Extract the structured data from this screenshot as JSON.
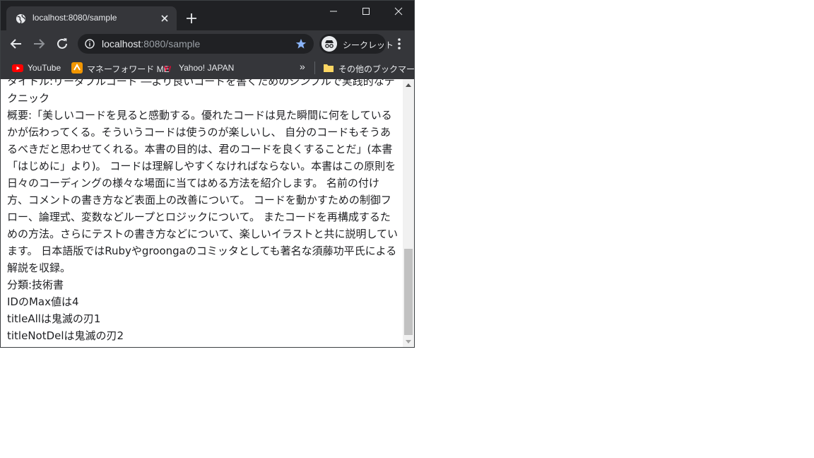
{
  "browser": {
    "tab_title": "localhost:8080/sample",
    "url_host": "localhost",
    "url_path": ":8080/sample",
    "incognito_label": "シークレット",
    "bookmarks": [
      {
        "label": "YouTube",
        "icon": "youtube-icon"
      },
      {
        "label": "マネーフォワード ME",
        "icon": "moneyforward-icon"
      },
      {
        "label": "Yahoo! JAPAN",
        "icon": "yahoo-icon"
      }
    ],
    "bookmarks_more": "»",
    "other_bookmarks_label": "その他のブックマーク"
  },
  "content": {
    "lines": [
      "タイトル:リーダブルコード ―より良いコードを書くためのシンプルで実践的なテクニック",
      "概要:「美しいコードを見ると感動する。優れたコードは見た瞬間に何をしているかが伝わってくる。そういうコードは使うのが楽しいし、 自分のコードもそうあるべきだと思わせてくれる。本書の目的は、君のコードを良くすることだ」(本書「はじめに」より)。 コードは理解しやすくなければならない。本書はこの原則を日々のコーディングの様々な場面に当てはめる方法を紹介します。 名前の付け方、コメントの書き方など表面上の改善について。 コードを動かすための制御フロー、論理式、変数などループとロジックについて。 またコードを再構成するための方法。さらにテストの書き方などについて、楽しいイラストと共に説明しています。 日本語版ではRubyやgroongaのコミッタとしても著名な須藤功平氏による解説を収録。",
      "分類:技術書",
      "IDのMax値は4",
      "titleAllは鬼滅の刃1",
      "titleNotDelは鬼滅の刃2"
    ]
  },
  "colors": {
    "frame": "#202124",
    "toolbar": "#35363a",
    "star": "#8ab4f8"
  }
}
